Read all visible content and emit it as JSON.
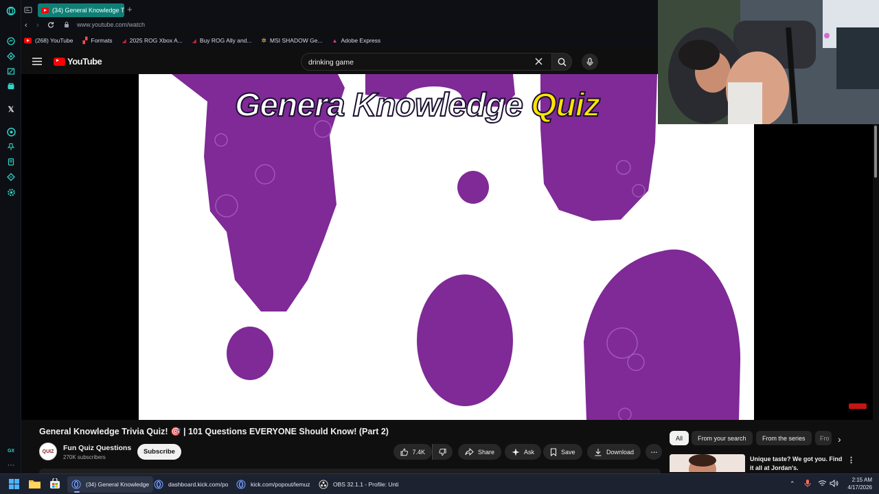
{
  "browser": {
    "tab_active_title": "(34) General Knowledge Tr",
    "url": "www.youtube.com/watch",
    "bookmarks": [
      {
        "label": "(268) YouTube"
      },
      {
        "label": "Formats"
      },
      {
        "label": "2025 ROG Xbox A..."
      },
      {
        "label": "Buy ROG Ally and..."
      },
      {
        "label": "MSI SHADOW Ge..."
      },
      {
        "label": "Adobe Express"
      }
    ],
    "rail_icons": [
      "opera-gx-icon",
      "messenger-icon",
      "diamond-icon",
      "twitch-icon",
      "layers-icon",
      "x-twitter-icon",
      "player-icon",
      "pinboard-icon",
      "history-icon",
      "extensions-icon",
      "settings-icon",
      "gx-icon",
      "more-icon"
    ],
    "rail_bottom_label": "GX"
  },
  "youtube": {
    "logo_text": "YouTube",
    "search_value": "drinking game",
    "video_title_text": "Genera Knowledge Quiz",
    "video": {
      "title": "General Knowledge Trivia Quiz! 🎯 | 101 Questions EVERYONE Should Know! (Part 2)",
      "channel_name": "Fun Quiz Questions",
      "channel_avatar_text": "QUIZ",
      "subscribers": "270K subscribers",
      "subscribe_label": "Subscribe",
      "like_count": "7.4K",
      "share_label": "Share",
      "ask_label": "Ask",
      "save_label": "Save",
      "download_label": "Download"
    },
    "chips": [
      {
        "label": "All"
      },
      {
        "label": "From your search"
      },
      {
        "label": "From the series"
      },
      {
        "label": "Fro"
      }
    ],
    "recommendation": {
      "title": "Unique taste? We got you. Find it all at Jordan's."
    }
  },
  "taskbar": {
    "apps": [
      {
        "label": "(34) General Knowledge"
      },
      {
        "label": "dashboard.kick.com/po"
      },
      {
        "label": "kick.com/popout/lemuz"
      },
      {
        "label": "OBS 32.1.1 - Profile: Unti"
      }
    ],
    "time": "2:15 AM",
    "date": "4/17/2026"
  },
  "colors": {
    "accent_teal": "#0f7f76",
    "quiz_purple": "#7f2a96",
    "quiz_yellow": "#ffe600",
    "youtube_red": "#ff0000"
  }
}
